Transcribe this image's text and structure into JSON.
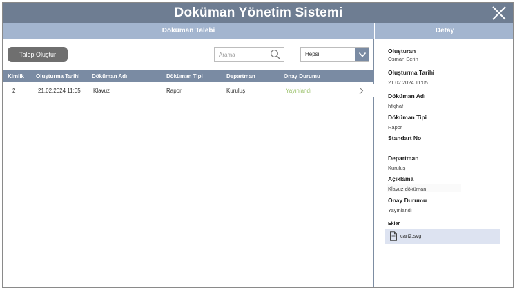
{
  "app": {
    "title": "Doküman Yönetim Sistemi"
  },
  "request_panel": {
    "header": "Döküman Talebi",
    "create_button": "Talep Oluştur",
    "search": {
      "placeholder": "Arama",
      "value": ""
    },
    "filter": {
      "selected": "Hepsi"
    },
    "columns": [
      "Kimlik",
      "Oluşturma Tarihi",
      "Döküman Adı",
      "Döküman Tipi",
      "Departman",
      "Onay Durumu"
    ],
    "rows": [
      {
        "id": "2",
        "created": "21.02.2024 11:05",
        "name": "Klavuz",
        "type": "Rapor",
        "department": "Kuruluş",
        "status": "Yayınlandı"
      }
    ]
  },
  "detail_panel": {
    "header": "Detay",
    "created_by_label": "Oluşturan",
    "created_by": "Osman Serin",
    "created_date_label": "Oluşturma Tarihi",
    "created_date": "21.02.2024 11:05",
    "doc_name_label": "Döküman Adı",
    "doc_name": "hfkjhaf",
    "doc_type_label": "Döküman Tipi",
    "doc_type": "Rapor",
    "standard_no_label": "Standart No",
    "standard_no": "",
    "department_label": "Departman",
    "department": "Kuruluş",
    "description_label": "Açıklama",
    "description": "Klavuz dökümanı",
    "approval_label": "Onay Durumu",
    "approval": "Yayınlandı",
    "attachments_label": "Ekler",
    "attachments": [
      {
        "name": "cart2.svg"
      }
    ]
  },
  "colors": {
    "titlebar": "#6e7d92",
    "section_header": "#a3b5cf",
    "table_header": "#7a8ba3",
    "status_published": "#9ac16a",
    "attachment_bg": "#dde3f1",
    "button": "#6f6f6f"
  },
  "icons": {
    "close": "close-icon",
    "search": "search-icon",
    "dropdown": "chevron-down-icon",
    "row": "chevron-right-icon",
    "attachment": "file-icon"
  }
}
